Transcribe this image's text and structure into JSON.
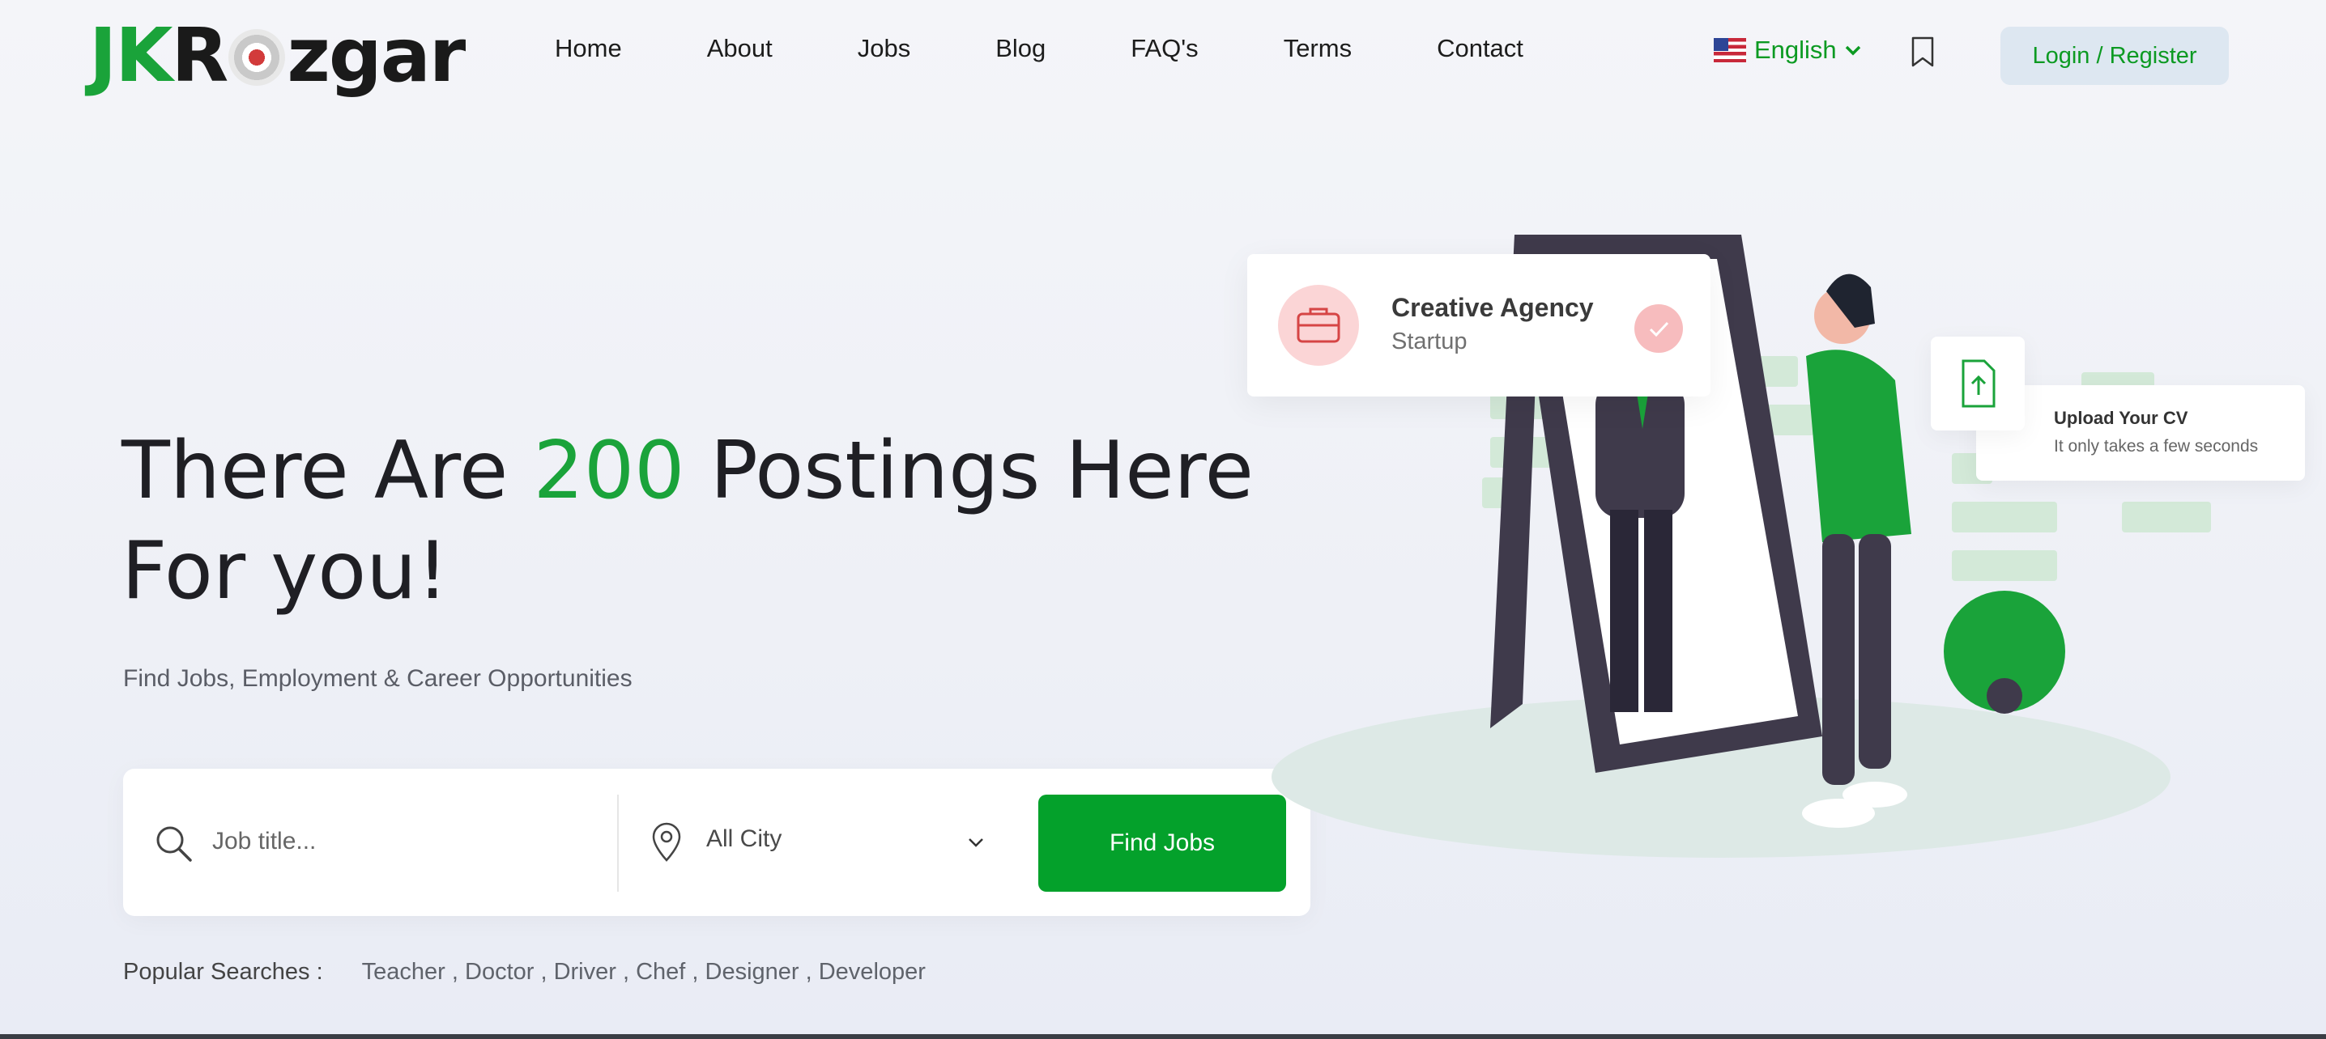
{
  "brand": {
    "logo_jk": "JK",
    "logo_r": "R",
    "logo_zgar": "zgar",
    "green": "#1aa33a",
    "button_green": "#04a12b"
  },
  "nav": {
    "items": [
      {
        "label": "Home"
      },
      {
        "label": "About"
      },
      {
        "label": "Jobs"
      },
      {
        "label": "Blog"
      },
      {
        "label": "FAQ's"
      },
      {
        "label": "Terms"
      },
      {
        "label": "Contact"
      }
    ]
  },
  "header": {
    "language": "English",
    "language_flag": "us-flag-icon",
    "bookmark_icon": "bookmark-icon",
    "login_label": "Login / Register"
  },
  "hero": {
    "title_pre": "There Are ",
    "title_count": "200",
    "title_post": " Postings Here For you!",
    "subtitle": "Find Jobs, Employment & Career Opportunities"
  },
  "search": {
    "job_placeholder": "Job title...",
    "city_value": "All City",
    "button_label": "Find Jobs"
  },
  "popular": {
    "label": "Popular Searches :",
    "items": "Teacher , Doctor , Driver , Chef , Designer , Developer"
  },
  "illustration": {
    "agency_title": "Creative Agency",
    "agency_sub": "Startup",
    "cv_title": "Upload Your CV",
    "cv_sub": "It only takes a few seconds"
  }
}
